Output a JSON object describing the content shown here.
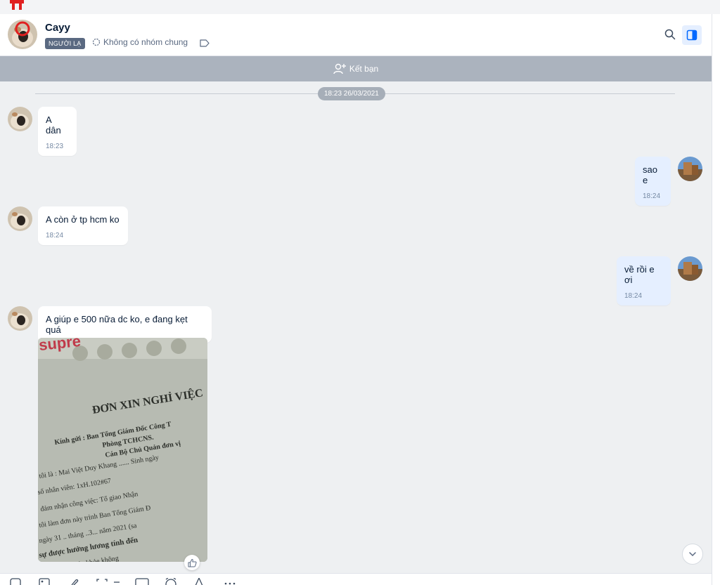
{
  "header": {
    "name": "Cayy",
    "badge": "NGƯỜI LẠ",
    "group_text": "Không có nhóm chung"
  },
  "friend_bar": {
    "label": "Kết bạn"
  },
  "date_separator": "18:23 26/03/2021",
  "messages": [
    {
      "sender": "other",
      "text": "A dân",
      "time": "18:23"
    },
    {
      "sender": "me",
      "text": "sao e",
      "time": "18:24"
    },
    {
      "sender": "other",
      "text": "A còn ở tp hcm ko",
      "time": "18:24"
    },
    {
      "sender": "me",
      "text": "về rồi e ơi",
      "time": "18:24"
    },
    {
      "sender": "other",
      "text": "A giúp e 500 nữa dc ko, e đang kẹt quá",
      "time": ""
    }
  ],
  "photo": {
    "title": "ĐƠN XIN NGHỈ VIỆC",
    "brand": "supre",
    "lines": [
      "Kính gửi :  Ban Tổng Giám Đốc Công T",
      "Phòng TCHCNS.",
      "Cán Bộ Chủ Quản đơn vị",
      "tôi là : Mai Việt Duy Khang ...... Sinh ngày",
      "số nhân viên: 1xH.102#67",
      "đảm nhận công việc: Tổ giao Nhận",
      "tôi làm đơn này trình Ban Tổng Giám Đ",
      "ngày 31 .. tháng ..3... năm 2021 (sa",
      "sự được hưởng lương tính đến",
      "riêng     sức khỏe không"
    ]
  },
  "colors": {
    "accent": "#0068ff",
    "my_bubble": "#e5efff",
    "friend_bar": "#abb3be"
  }
}
